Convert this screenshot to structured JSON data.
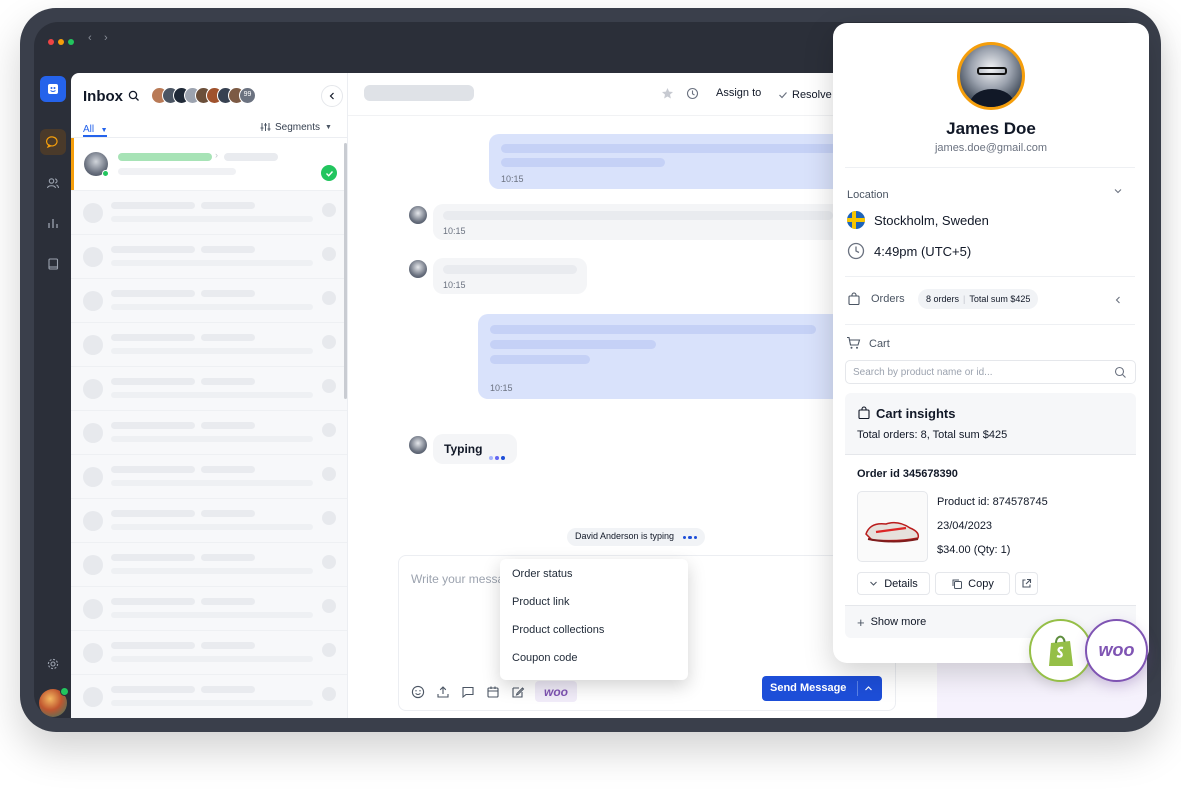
{
  "inbox": {
    "title": "Inbox",
    "filter_label": "All",
    "segments_label": "Segments",
    "avatars_more": "99"
  },
  "chat": {
    "header": {
      "assign_label": "Assign to",
      "resolve_label": "Resolve"
    },
    "messages": [
      {
        "time": "10:15"
      },
      {
        "time": "10:15"
      },
      {
        "time": "10:15"
      },
      {
        "time": "10:15"
      }
    ],
    "typing_label": "Typing",
    "typing_notice": "David Anderson is typing",
    "composer": {
      "placeholder": "Write your message",
      "send_label": "Send Message",
      "woo_label": "woo"
    },
    "dropdown": {
      "items": [
        "Order status",
        "Product link",
        "Product collections",
        "Coupon code"
      ]
    }
  },
  "contact": {
    "name": "James Doe",
    "email": "james.doe@gmail.com",
    "location_label": "Location",
    "location": "Stockholm, Sweden",
    "time": "4:49pm (UTC+5)",
    "orders_label": "Orders",
    "orders_count": "8 orders",
    "orders_total": "Total sum $425",
    "cart_label": "Cart",
    "cart_search_placeholder": "Search by product name or id...",
    "insights": {
      "title": "Cart insights",
      "summary": "Total orders: 8, Total sum $425",
      "order_id": "Order id 345678390",
      "product_id": "Product id: 874578745",
      "date": "23/04/2023",
      "price": "$34.00 (Qty: 1)",
      "details_label": "Details",
      "copy_label": "Copy",
      "show_more_label": "Show more"
    },
    "integrations": {
      "woo_label": "woo"
    }
  },
  "colors": {
    "accent": "#1d4ed8",
    "outgoing_bubble": "#d9e2fb",
    "woo_purple": "#7f54b3",
    "shopify_green": "#95bf47",
    "success": "#22c55e"
  }
}
